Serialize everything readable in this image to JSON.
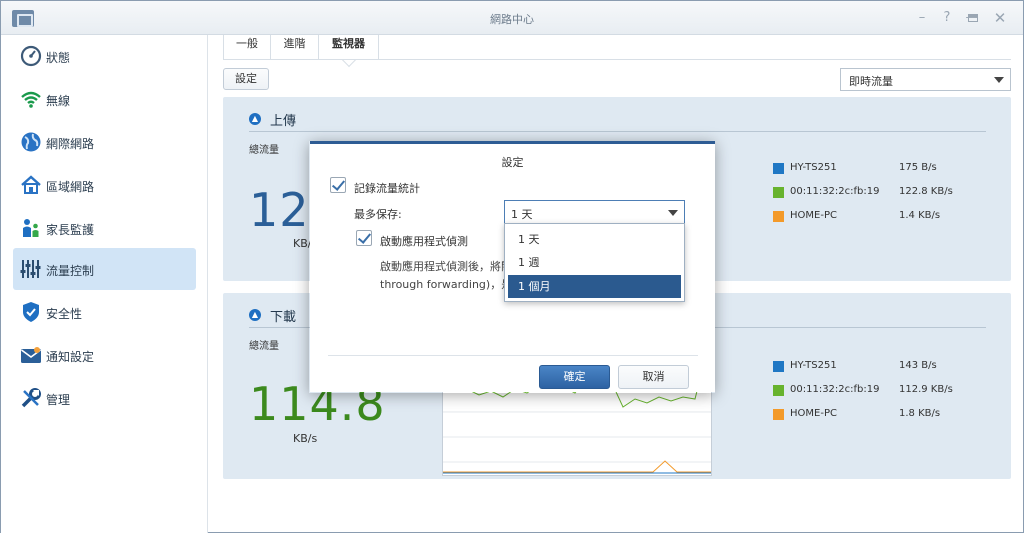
{
  "window": {
    "title": "網路中心",
    "controls": [
      "pin",
      "help",
      "minimize",
      "maximize",
      "close"
    ]
  },
  "sidebar": {
    "items": [
      {
        "label": "狀態",
        "icon": "gauge-icon"
      },
      {
        "label": "無線",
        "icon": "wifi-icon"
      },
      {
        "label": "網際網路",
        "icon": "globe-icon"
      },
      {
        "label": "區域網路",
        "icon": "house-icon"
      },
      {
        "label": "家長監護",
        "icon": "family-icon"
      },
      {
        "label": "流量控制",
        "icon": "sliders-icon",
        "active": true
      },
      {
        "label": "安全性",
        "icon": "shield-icon"
      },
      {
        "label": "通知設定",
        "icon": "mail-icon"
      },
      {
        "label": "管理",
        "icon": "tools-icon"
      }
    ]
  },
  "tabs": [
    {
      "label": "一般"
    },
    {
      "label": "進階"
    },
    {
      "label": "監視器",
      "active": true
    }
  ],
  "toolbar": {
    "settings_label": "設定",
    "view_select": "即時流量"
  },
  "upload": {
    "title": "上傳",
    "total_label": "總流量",
    "value": "12",
    "unit": "KB/s",
    "legend": [
      {
        "name": "HY-TS251",
        "value": "175 B/s",
        "color": "#1f77c4"
      },
      {
        "name": "00:11:32:2c:fb:19",
        "value": "122.8 KB/s",
        "color": "#67b32e"
      },
      {
        "name": "HOME-PC",
        "value": "1.4 KB/s",
        "color": "#f39a2a"
      }
    ]
  },
  "download": {
    "title": "下載",
    "total_label": "總流量",
    "value": "114.8",
    "unit": "KB/s",
    "legend": [
      {
        "name": "HY-TS251",
        "value": "143 B/s",
        "color": "#1f77c4"
      },
      {
        "name": "00:11:32:2c:fb:19",
        "value": "112.9 KB/s",
        "color": "#67b32e"
      },
      {
        "name": "HOME-PC",
        "value": "1.8 KB/s",
        "color": "#f39a2a"
      }
    ]
  },
  "dialog": {
    "title": "設定",
    "record_label": "記錄流量統計",
    "record_checked": true,
    "max_keep_label": "最多保存:",
    "max_keep_value": "1 天",
    "enable_detect_label": "啟動應用程式偵測",
    "enable_detect_checked": true,
    "desc_line1": "啟動應用程式偵測後，將關",
    "desc_line2": "through forwarding)，是",
    "ok_label": "確定",
    "cancel_label": "取消",
    "dropdown_options": [
      "1 天",
      "1 週",
      "1 個月"
    ],
    "dropdown_highlighted": "1 個月"
  }
}
